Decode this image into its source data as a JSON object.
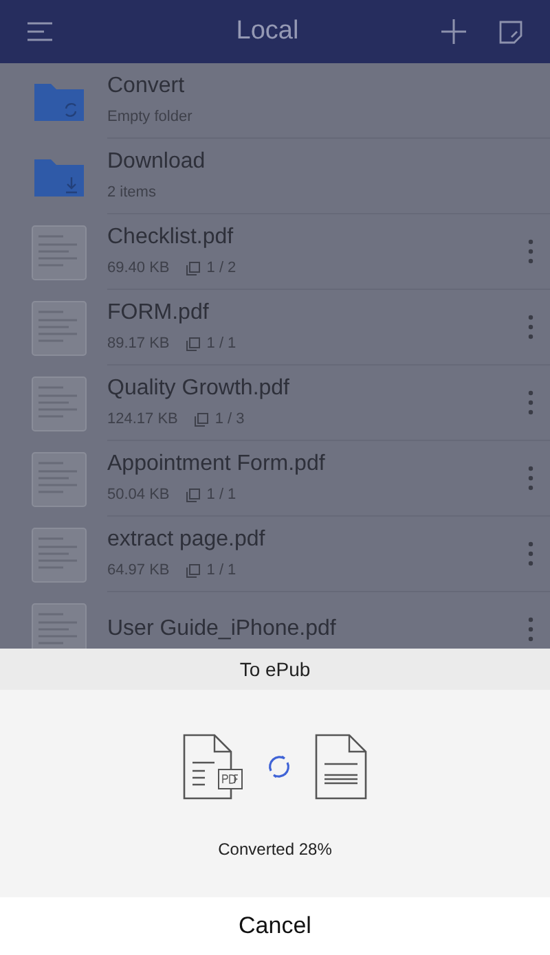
{
  "header": {
    "title": "Local"
  },
  "items": [
    {
      "kind": "sync_folder",
      "name": "Convert",
      "detail": "Empty folder"
    },
    {
      "kind": "download_folder",
      "name": "Download",
      "detail": "2 items"
    },
    {
      "kind": "file",
      "name": "Checklist.pdf",
      "size": "69.40 KB",
      "pages": "1 / 2"
    },
    {
      "kind": "file",
      "name": "FORM.pdf",
      "size": "89.17 KB",
      "pages": "1 / 1"
    },
    {
      "kind": "file",
      "name": "Quality Growth.pdf",
      "size": "124.17 KB",
      "pages": "1 / 3"
    },
    {
      "kind": "file",
      "name": "Appointment Form.pdf",
      "size": "50.04 KB",
      "pages": "1 / 1"
    },
    {
      "kind": "file",
      "name": "extract page.pdf",
      "size": "64.97 KB",
      "pages": "1 / 1"
    },
    {
      "kind": "file",
      "name": "User Guide_iPhone.pdf"
    }
  ],
  "sheet": {
    "title": "To ePub",
    "status": "Converted 28%",
    "cancel": "Cancel"
  }
}
